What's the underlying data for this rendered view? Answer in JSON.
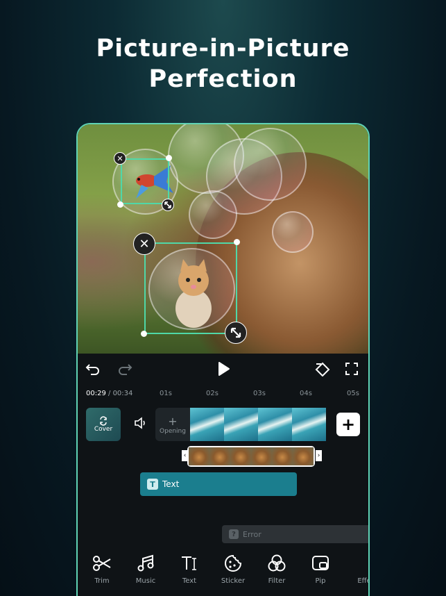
{
  "headline": {
    "line1": "Picture-in-Picture",
    "line2": "Perfection"
  },
  "toolbar": {
    "undo": "undo-icon",
    "redo": "redo-icon",
    "play": "play-icon",
    "keyframe": "keyframe-icon",
    "fullscreen": "fullscreen-icon"
  },
  "timeline": {
    "current_time": "00:29",
    "separator": " / ",
    "total_time": "00:34",
    "ticks": [
      "01s",
      "02s",
      "03s",
      "04s",
      "05s"
    ],
    "cover_label": "Cover",
    "opening_label": "Opening",
    "opening_plus": "+",
    "add_clip": "+",
    "text_track_label": "Text",
    "text_track_icon": "T",
    "error_track_label": "Error",
    "error_track_icon": "?"
  },
  "bottom_tools": [
    {
      "label": "Trim",
      "icon": "scissors-icon"
    },
    {
      "label": "Music",
      "icon": "music-icon"
    },
    {
      "label": "Text",
      "icon": "text-icon"
    },
    {
      "label": "Sticker",
      "icon": "sticker-icon"
    },
    {
      "label": "Filter",
      "icon": "filter-icon"
    },
    {
      "label": "Pip",
      "icon": "pip-icon"
    },
    {
      "label": "Effe",
      "icon": "effect-icon"
    }
  ],
  "colors": {
    "accent": "#5fd3b5",
    "pip_border": "#4fd8a8",
    "text_track": "#1b7e8e",
    "background": "#071821"
  }
}
